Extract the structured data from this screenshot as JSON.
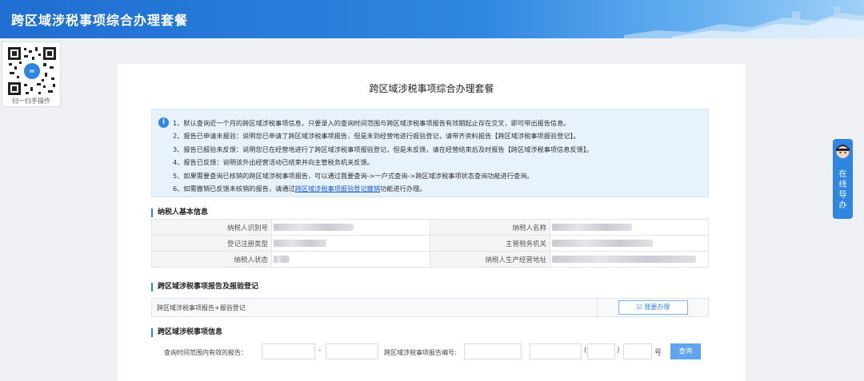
{
  "header": {
    "title": "跨区域涉税事项综合办理套餐"
  },
  "qr": {
    "caption": "扫一扫手操作"
  },
  "side_float": {
    "label": "在线导办"
  },
  "panel": {
    "title": "跨区域涉税事项综合办理套餐",
    "notice": {
      "lines": [
        "1、默认查询近一个月的跨区域涉税事项信息，只要录入的查询时间范围与跨区域涉税事项报告有效期起止存在交叉，即可带出报告信息。",
        "2、报告已申请未报验：说明您已申请了跨区域涉税事项报告，但是未到经营地进行报验登记，请带齐资料报告【跨区域涉税事项报验登记】。",
        "3、报告已报验未反馈：说明您已在经营地进行了跨区域涉税事项报验登记，但是未反馈，请在经营结束后及时报告【跨区域涉税事项信息反馈】。",
        "4、报告已反馈：说明该外出经营活动已结束并向主管税务机关反馈。",
        "5、如果需要查询已核销的跨区域涉税事项报告，可以通过我要查询->一户式查询->跨区域涉税事项状态查询功能进行查询。"
      ],
      "line6_prefix": "6、如需撤销已反馈未核销的报告，请通过",
      "line6_link": "跨区域涉税事项报验登记撤销",
      "line6_suffix": "功能进行办理。"
    },
    "basic_info": {
      "title": "纳税人基本信息",
      "rows": [
        {
          "l1": "纳税人识别号",
          "l2": "纳税人名称"
        },
        {
          "l1": "登记注册类型",
          "l2": "主管税务机关"
        },
        {
          "l1": "纳税人状态",
          "l2": "纳税人生产经营地址"
        }
      ]
    },
    "report_reg": {
      "title": "跨区域涉税事项报告及报验登记",
      "row_label": "跨区域涉税事项报告+报验登记",
      "button": "☑ 我要办理"
    },
    "query": {
      "title": "跨区域涉税事项信息",
      "range_label": "查询时间范围内有效的报告：",
      "dash": "-",
      "number_label": "跨区域涉税事项报告编号:",
      "bracket_open": "(",
      "bracket_close": ")",
      "hao": "号",
      "button": "查询"
    }
  },
  "colors": {
    "header_blue": "#1f6ed1",
    "accent": "#2f86e0",
    "notice_bg": "#e8f2fd"
  }
}
